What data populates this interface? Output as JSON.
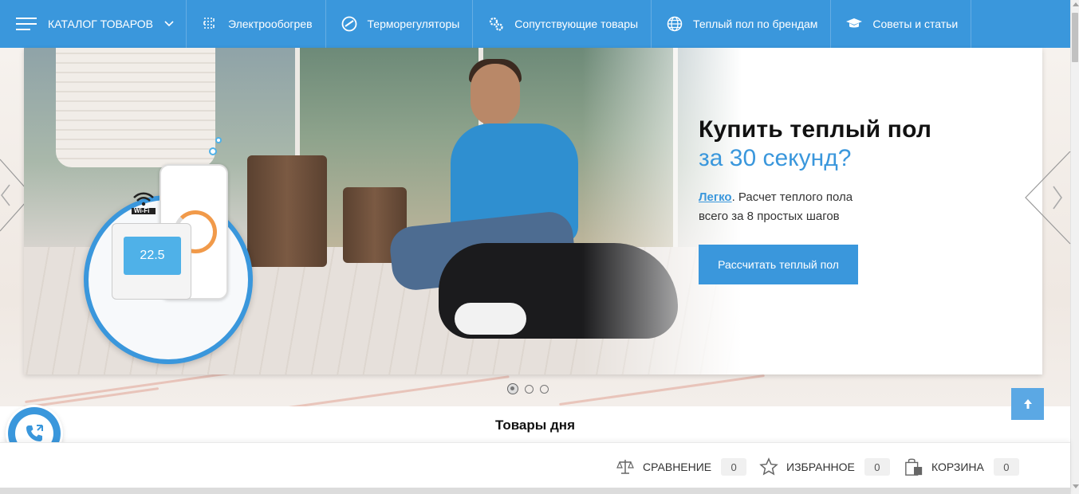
{
  "nav": {
    "catalog_label": "КАТАЛОГ ТОВАРОВ",
    "items": [
      {
        "label": "Электрообогрев",
        "icon": "heating-coil-icon"
      },
      {
        "label": "Терморегуляторы",
        "icon": "gauge-icon"
      },
      {
        "label": "Сопутствующие товары",
        "icon": "gears-icon"
      },
      {
        "label": "Теплый пол по брендам",
        "icon": "globe-icon"
      },
      {
        "label": "Советы и статьи",
        "icon": "graduation-cap-icon"
      }
    ]
  },
  "hero": {
    "title": "Купить теплый пол",
    "subtitle": "за 30 секунд?",
    "desc_link": "Легко",
    "desc_line1": ". Расчет теплого пола",
    "desc_line2": "всего за 8 простых шагов",
    "cta_label": "Рассчитать теплый пол",
    "thermostat_reading": "22.5",
    "wifi_label": "Wi-Fi",
    "slides_total": 3,
    "active_slide": 1
  },
  "section": {
    "title": "Товары дня"
  },
  "bottom_bar": {
    "compare_label": "СРАВНЕНИЕ",
    "compare_count": "0",
    "favorites_label": "ИЗБРАННОЕ",
    "favorites_count": "0",
    "cart_label": "КОРЗИНА",
    "cart_count": "0"
  },
  "colors": {
    "brand_blue": "#3a97dc",
    "button_blue": "#3a97dc",
    "text_dark": "#111111"
  }
}
